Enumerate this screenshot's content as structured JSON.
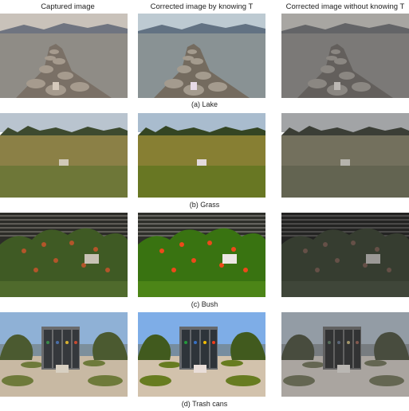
{
  "column_headers": [
    "Captured image",
    "Corrected image by knowing T",
    "Corrected image without knowing T"
  ],
  "rows": [
    {
      "caption": "(a) Lake"
    },
    {
      "caption": "(b) Grass"
    },
    {
      "caption": "(c) Bush"
    },
    {
      "caption": "(d) Trash cans"
    }
  ]
}
